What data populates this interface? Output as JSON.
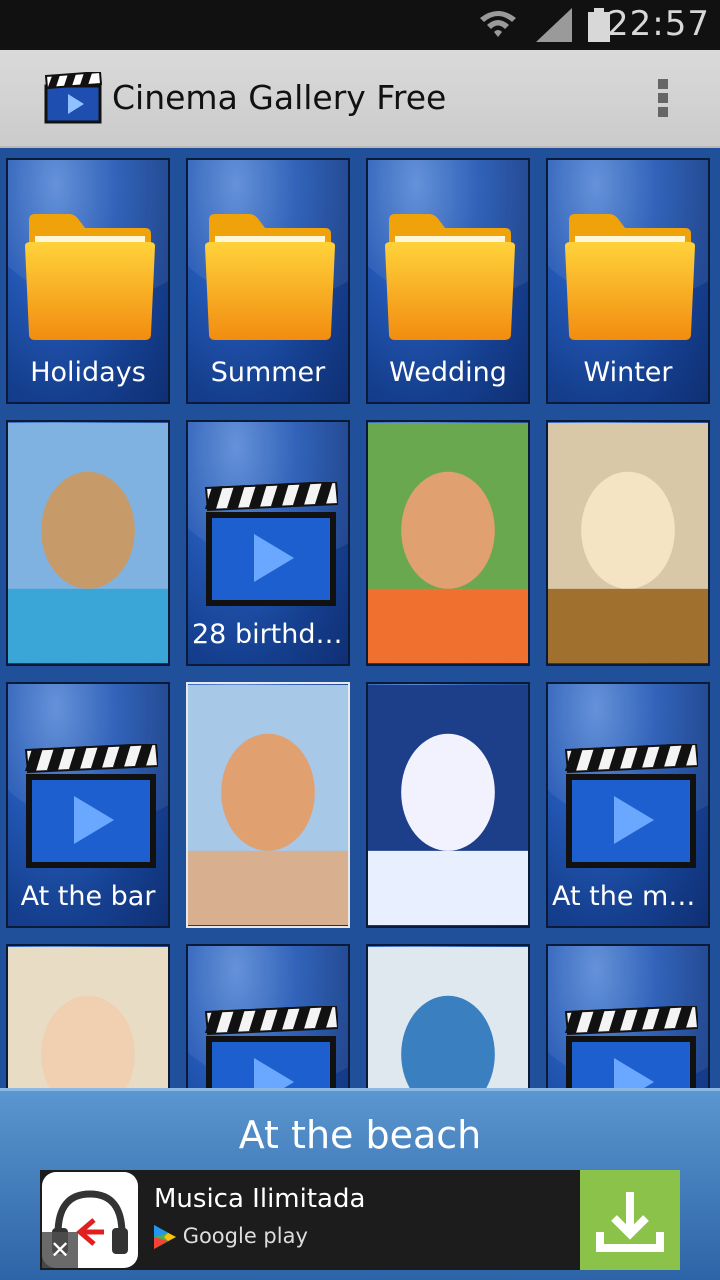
{
  "status_bar": {
    "time": "22:57"
  },
  "app": {
    "title": "Cinema Gallery Free"
  },
  "grid": {
    "tiles": [
      {
        "kind": "folder",
        "label": "Holidays"
      },
      {
        "kind": "folder",
        "label": "Summer"
      },
      {
        "kind": "folder",
        "label": "Wedding"
      },
      {
        "kind": "folder",
        "label": "Winter"
      },
      {
        "kind": "photo",
        "label": ""
      },
      {
        "kind": "video",
        "label": "28 birthday"
      },
      {
        "kind": "photo",
        "label": ""
      },
      {
        "kind": "photo",
        "label": ""
      },
      {
        "kind": "video",
        "label": "At the bar"
      },
      {
        "kind": "photo",
        "label": "",
        "selected": true
      },
      {
        "kind": "photo",
        "label": ""
      },
      {
        "kind": "video",
        "label": "At the movi…"
      },
      {
        "kind": "photo",
        "label": ""
      },
      {
        "kind": "video",
        "label": ""
      },
      {
        "kind": "photo",
        "label": ""
      },
      {
        "kind": "video",
        "label": ""
      }
    ]
  },
  "selected_caption": "At the beach",
  "ad": {
    "title": "Musica Ilimitada",
    "store": "Google play",
    "close": "✕"
  },
  "colors": {
    "grid_bg": "#21509a",
    "folder": "#fbb814",
    "download": "#8bc34a"
  }
}
